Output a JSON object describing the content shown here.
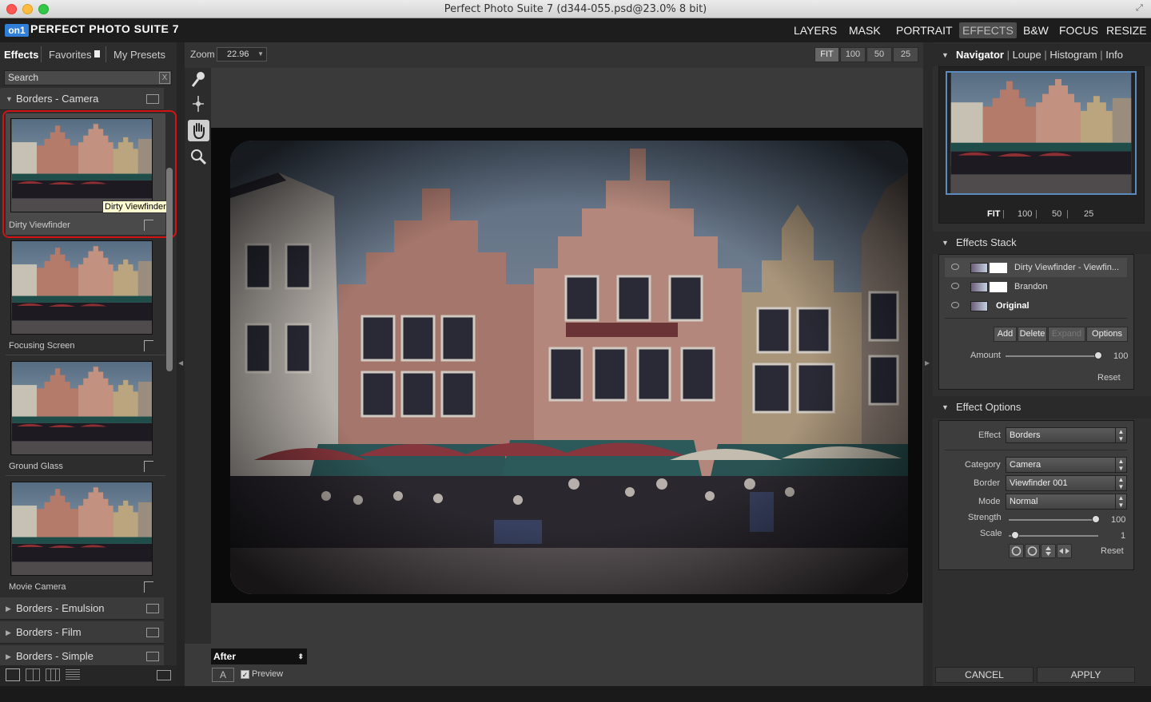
{
  "window": {
    "title": "Perfect Photo Suite 7 (d344-055.psd@23.0% 8 bit)"
  },
  "app": {
    "logo": "on1",
    "title": "PERFECT PHOTO SUITE 7"
  },
  "modules": [
    "LAYERS",
    "MASK",
    "PORTRAIT",
    "EFFECTS",
    "B&W",
    "FOCUS",
    "RESIZE"
  ],
  "active_module": "EFFECTS",
  "left": {
    "tabs": {
      "effects": "Effects",
      "favorites": "Favorites",
      "presets": "My Presets"
    },
    "search": {
      "placeholder": "Search",
      "clear": "X"
    },
    "open_category": "Borders - Camera",
    "presets": [
      {
        "name": "Dirty Viewfinder"
      },
      {
        "name": "Focusing Screen"
      },
      {
        "name": "Ground Glass"
      },
      {
        "name": "Movie Camera"
      }
    ],
    "tooltip": "Dirty Viewfinder",
    "collapsed_categories": [
      "Borders - Emulsion",
      "Borders - Film",
      "Borders - Simple"
    ]
  },
  "center": {
    "zoom_label": "Zoom",
    "zoom_value": "22.96",
    "zoom_buttons": [
      "FIT",
      "100",
      "50",
      "25"
    ],
    "view_mode": "After",
    "a_button": "A",
    "preview_label": "Preview",
    "preview_checked": true
  },
  "right": {
    "nav_tabs": [
      "Navigator",
      "Loupe",
      "Histogram",
      "Info"
    ],
    "nav_zoom": [
      "FIT",
      "100",
      "50",
      "25"
    ],
    "effects_stack": {
      "title": "Effects Stack",
      "layers": [
        {
          "name": "Dirty Viewfinder - Viewfin...",
          "bold": false
        },
        {
          "name": "Brandon",
          "bold": false
        },
        {
          "name": "Original",
          "bold": true
        }
      ],
      "buttons": {
        "add": "Add",
        "delete": "Delete",
        "expand": "Expand",
        "options": "Options"
      },
      "amount_label": "Amount",
      "amount_value": "100",
      "reset": "Reset"
    },
    "effect_options": {
      "title": "Effect Options",
      "effect_label": "Effect",
      "effect_value": "Borders",
      "category_label": "Category",
      "category_value": "Camera",
      "border_label": "Border",
      "border_value": "Viewfinder 001",
      "mode_label": "Mode",
      "mode_value": "Normal",
      "strength_label": "Strength",
      "strength_value": "100",
      "scale_label": "Scale",
      "scale_value": "1",
      "reset": "Reset"
    },
    "cancel": "CANCEL",
    "apply": "APPLY"
  },
  "colors": {
    "accent_blue": "#2f7ed8",
    "selection_red": "#d31313",
    "nav_border": "#5b8cc0"
  }
}
